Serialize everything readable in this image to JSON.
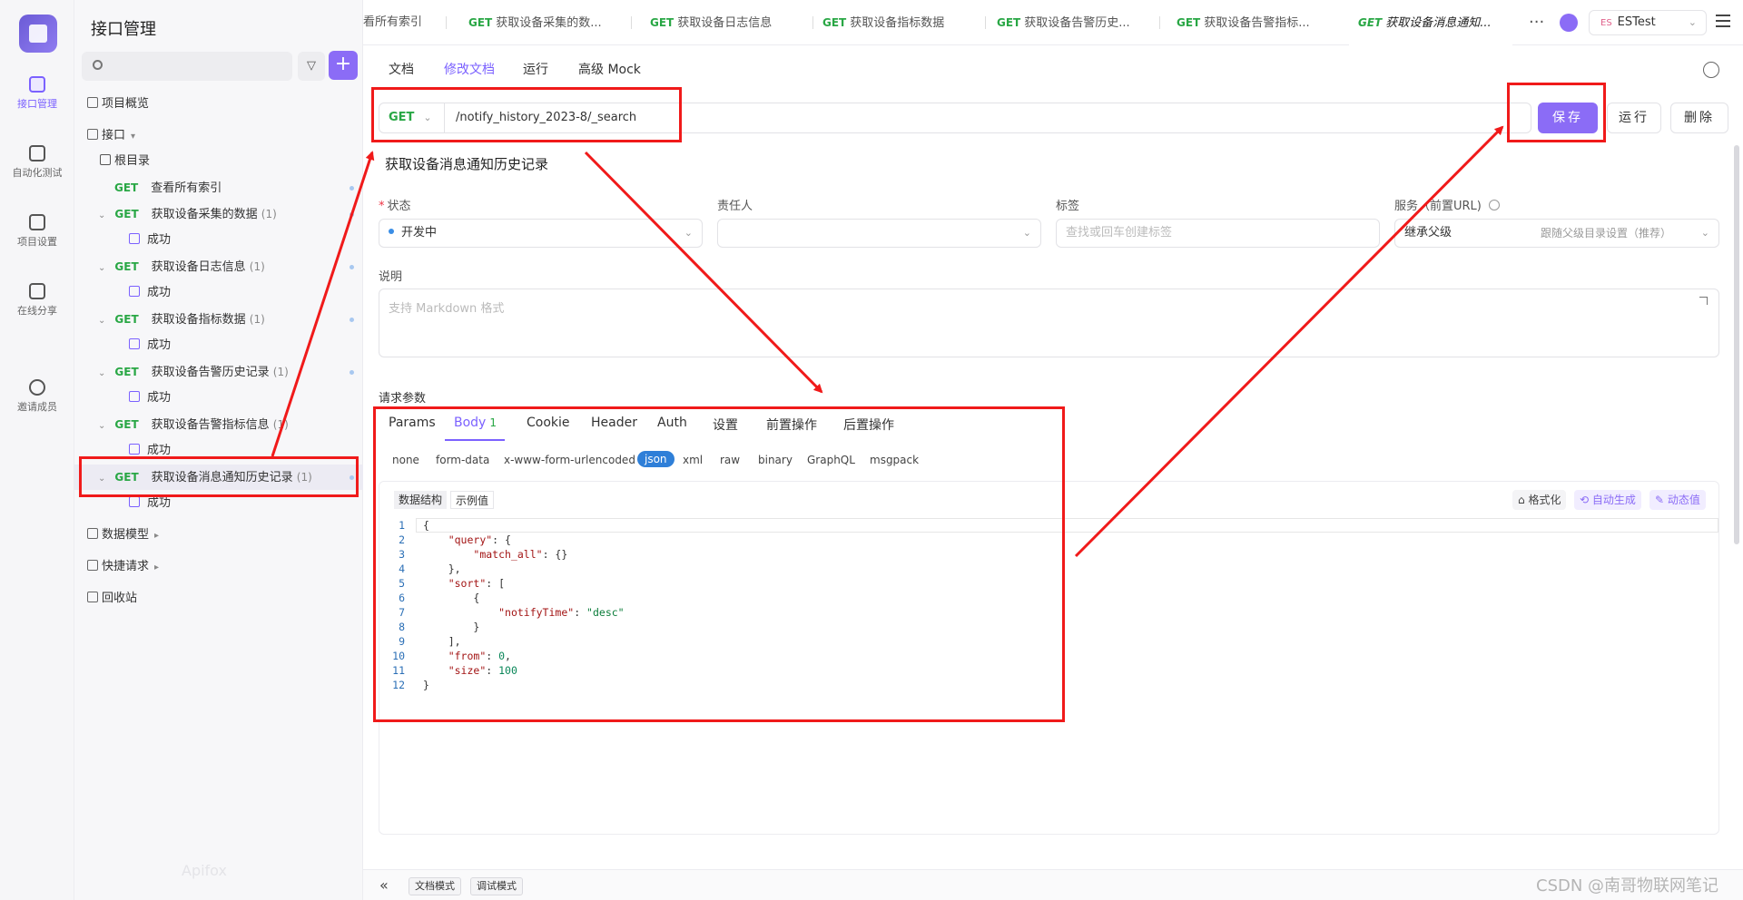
{
  "rail": {
    "items": [
      {
        "label": "接口管理"
      },
      {
        "label": "自动化测试"
      },
      {
        "label": "项目设置"
      },
      {
        "label": "在线分享"
      },
      {
        "label": "邀请成员"
      }
    ]
  },
  "sidebar": {
    "title": "接口管理",
    "overview": "项目概览",
    "interfaces": "接口",
    "root": "根目录",
    "items": [
      {
        "method": "GET",
        "name": "查看所有索引",
        "count": ""
      },
      {
        "method": "GET",
        "name": "获取设备采集的数据",
        "count": "(1)"
      },
      {
        "method": "GET",
        "name": "获取设备日志信息",
        "count": "(1)"
      },
      {
        "method": "GET",
        "name": "获取设备指标数据",
        "count": "(1)"
      },
      {
        "method": "GET",
        "name": "获取设备告警历史记录",
        "count": "(1)"
      },
      {
        "method": "GET",
        "name": "获取设备告警指标信息",
        "count": "(1)"
      },
      {
        "method": "GET",
        "name": "获取设备消息通知历史记录",
        "count": "(1)"
      }
    ],
    "success_label": "成功",
    "data_model": "数据模型",
    "quick_request": "快捷请求",
    "recycle": "回收站",
    "faint_brand": "Apifox"
  },
  "top_tabs": [
    {
      "method": "",
      "label": "看所有索引"
    },
    {
      "method": "GET",
      "label": "获取设备采集的数..."
    },
    {
      "method": "GET",
      "label": "获取设备日志信息"
    },
    {
      "method": "GET",
      "label": "获取设备指标数据"
    },
    {
      "method": "GET",
      "label": "获取设备告警历史..."
    },
    {
      "method": "GET",
      "label": "获取设备告警指标..."
    },
    {
      "method": "GET",
      "label": "获取设备消息通知..."
    }
  ],
  "more": "···",
  "env": {
    "badge": "ES",
    "name": "ESTest"
  },
  "sub_tabs": [
    "文档",
    "修改文档",
    "运行",
    "高级 Mock"
  ],
  "request": {
    "method": "GET",
    "url": "/notify_history_2023-8/_search",
    "save": "保存",
    "run": "运行",
    "delete": "删除"
  },
  "api_name": "获取设备消息通知历史记录",
  "fields": {
    "status_label": "状态",
    "status_value": "开发中",
    "owner_label": "责任人",
    "tag_label": "标签",
    "tag_placeholder": "查找或回车创建标签",
    "service_label": "服务（前置URL)",
    "service_value": "继承父级",
    "service_hint": "跟随父级目录设置（推荐）",
    "desc_label": "说明",
    "desc_placeholder": "支持 Markdown 格式"
  },
  "params": {
    "section_label": "请求参数",
    "tabs": [
      "Params",
      "Body",
      "Cookie",
      "Header",
      "Auth",
      "设置",
      "前置操作",
      "后置操作"
    ],
    "body_badge": "1",
    "body_types": [
      "none",
      "form-data",
      "x-www-form-urlencoded",
      "json",
      "xml",
      "raw",
      "binary",
      "GraphQL",
      "msgpack"
    ],
    "seg_schema": "数据结构",
    "seg_example": "示例值",
    "tool_format": "格式化",
    "tool_auto": "自动生成",
    "tool_dynamic": "动态值"
  },
  "code_lines": [
    "{",
    "    \"query\": {",
    "        \"match_all\": {}",
    "    },",
    "    \"sort\": [",
    "        {",
    "            \"notifyTime\": \"desc\"",
    "        }",
    "    ],",
    "    \"from\": 0,",
    "    \"size\": 100",
    "}"
  ],
  "bottom": {
    "collapse": "«",
    "doc_mode": "文档模式",
    "debug_mode": "调试模式"
  },
  "watermark": "CSDN @南哥物联网笔记",
  "colors": {
    "accent": "#8b6cf6",
    "get": "#29a745",
    "annotation": "#f01a1a"
  }
}
